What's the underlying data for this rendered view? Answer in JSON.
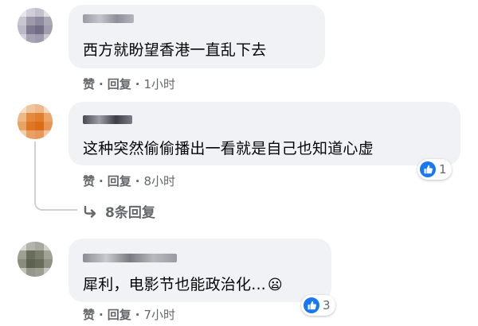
{
  "comments": [
    {
      "text": "西方就盼望香港一直乱下去",
      "actions": {
        "like": "赞",
        "reply": "回复",
        "time": "1小时"
      }
    },
    {
      "text": "这种突然偷偷播出一看就是自己也知道心虚",
      "actions": {
        "like": "赞",
        "reply": "回复",
        "time": "8小时"
      },
      "reaction_count": "1",
      "replies_label": "8条回复"
    },
    {
      "text": "犀利，电影节也能政治化...",
      "emoji": "😦",
      "actions": {
        "like": "赞",
        "reply": "回复",
        "time": "7小时"
      },
      "reaction_count": "3"
    }
  ],
  "separator": "·",
  "colors": {
    "bubble": "#f0f2f5",
    "meta_text": "#65676b",
    "like_blue": "#1877f2",
    "thread_line": "#ced0d4"
  },
  "icons": [
    "like-icon",
    "reply-arrow-icon",
    "sad-face-emoji"
  ]
}
